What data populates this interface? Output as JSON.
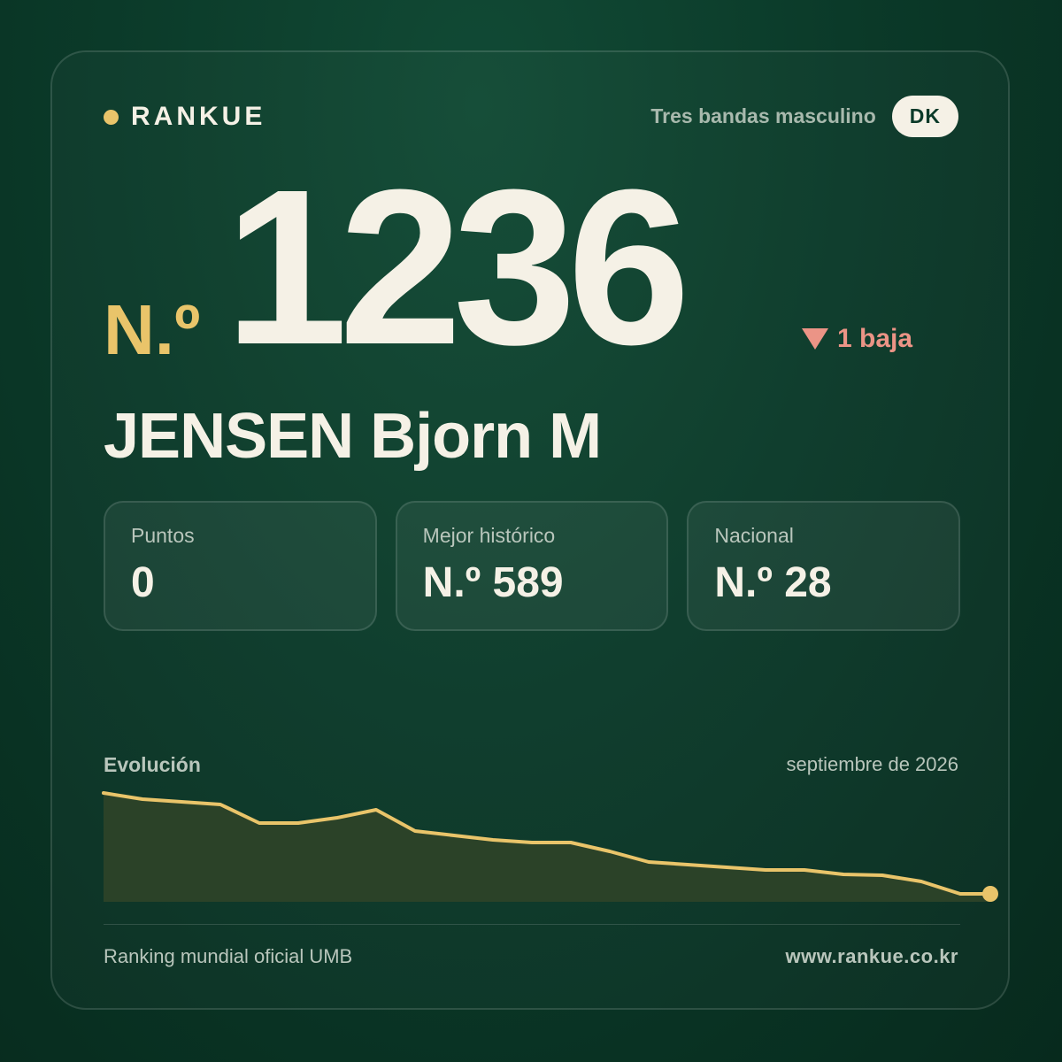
{
  "brand": {
    "name": "RANKUE",
    "dot_color": "#e9c46a"
  },
  "header": {
    "category": "Tres bandas masculino",
    "country_code": "DK"
  },
  "rank": {
    "prefix": "N.º",
    "number": "1236",
    "change_text": "1 baja",
    "change_direction": "down",
    "accent_color": "#e9c46a",
    "change_color": "#eb9486"
  },
  "player": {
    "name": "JENSEN Bjorn M"
  },
  "stats": [
    {
      "label": "Puntos",
      "value": "0"
    },
    {
      "label": "Mejor histórico",
      "value": "N.º 589"
    },
    {
      "label": "Nacional",
      "value": "N.º 28"
    }
  ],
  "evolution": {
    "title": "Evolución",
    "date": "septiembre de 2026",
    "line_color": "#e9c46a",
    "fill_color": "#2b4228"
  },
  "chart_data": {
    "type": "area",
    "title": "Evolución",
    "x": [
      0,
      1,
      2,
      3,
      4,
      5,
      6,
      7,
      8,
      9,
      10,
      11,
      12,
      13,
      14,
      15,
      16,
      17,
      18,
      19,
      20,
      21,
      22
    ],
    "values": [
      897,
      904,
      907,
      910,
      931,
      931,
      925,
      916,
      940,
      945,
      950,
      953,
      953,
      963,
      975,
      978,
      981,
      984,
      984,
      989,
      990,
      997,
      1011
    ],
    "ylim": [
      890,
      1020
    ],
    "y_inverted": true,
    "endpoint": 1236,
    "grid": false,
    "legend": "none"
  },
  "footer": {
    "source": "Ranking mundial oficial UMB",
    "website": "www.rankue.co.kr"
  }
}
